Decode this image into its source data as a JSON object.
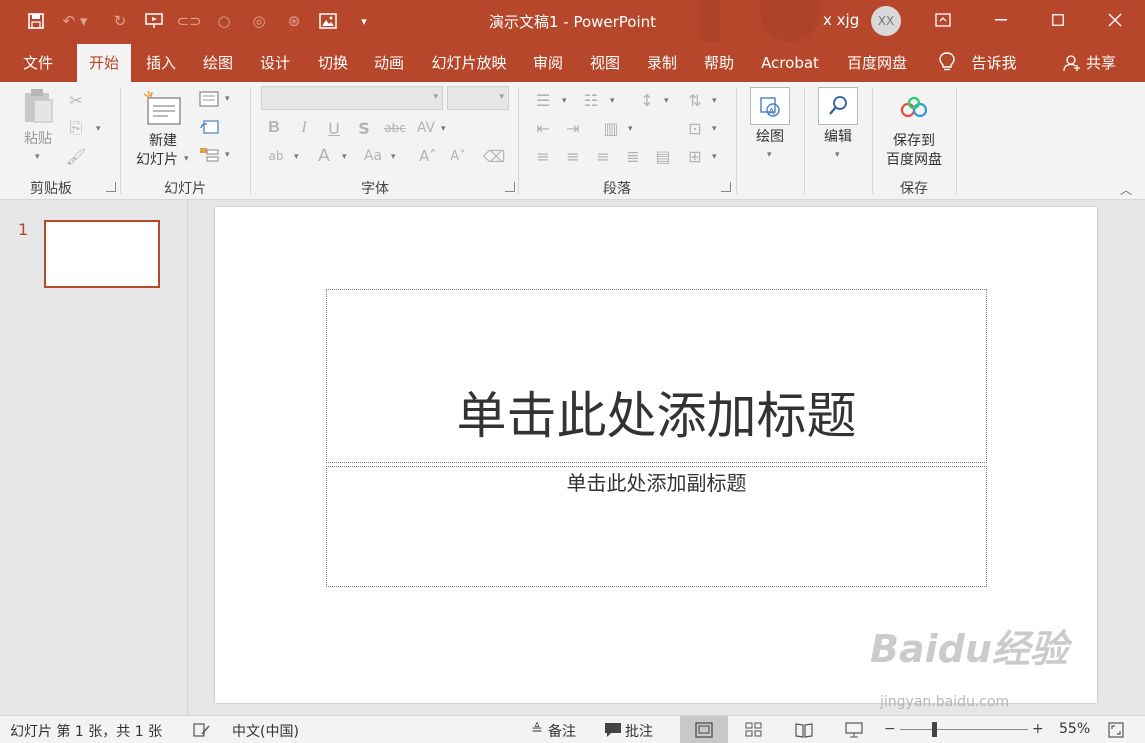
{
  "window": {
    "title": "演示文稿1  -  PowerPoint",
    "user_name": "x xjg",
    "avatar_initials": "XX",
    "accent_color": "#b7472a"
  },
  "quick_access": {
    "icons": [
      "save-icon",
      "undo-icon",
      "redo-icon",
      "present-from-start-icon",
      "shape-union-icon",
      "shape-combine-icon",
      "shape-fragment-icon",
      "shape-intersect-icon",
      "insert-picture-icon",
      "customize-toolbar-icon"
    ]
  },
  "tabs": [
    {
      "label": "文件"
    },
    {
      "label": "开始"
    },
    {
      "label": "插入"
    },
    {
      "label": "绘图"
    },
    {
      "label": "设计"
    },
    {
      "label": "切换"
    },
    {
      "label": "动画"
    },
    {
      "label": "幻灯片放映"
    },
    {
      "label": "审阅"
    },
    {
      "label": "视图"
    },
    {
      "label": "录制"
    },
    {
      "label": "帮助"
    },
    {
      "label": "Acrobat"
    },
    {
      "label": "百度网盘"
    }
  ],
  "tell_me": "告诉我",
  "share": "共享",
  "ribbon": {
    "clipboard": {
      "label": "剪贴板",
      "paste": "粘贴"
    },
    "slides": {
      "label": "幻灯片",
      "new_slide_1": "新建",
      "new_slide_2": "幻灯片"
    },
    "font": {
      "label": "字体",
      "font_name": "",
      "font_size": ""
    },
    "paragraph": {
      "label": "段落"
    },
    "drawing": {
      "label": "绘图"
    },
    "editing": {
      "label": "编辑"
    },
    "save": {
      "label": "保存",
      "save_to_1": "保存到",
      "save_to_2": "百度网盘"
    }
  },
  "thumbnails": [
    {
      "number": "1"
    }
  ],
  "slide": {
    "title_placeholder": "单击此处添加标题",
    "subtitle_placeholder": "单击此处添加副标题"
  },
  "watermark": {
    "brand": "Baidu经验",
    "url": "jingyan.baidu.com"
  },
  "status": {
    "slide_info": "幻灯片 第 1 张，共 1 张",
    "language": "中文(中国)",
    "notes": "备注",
    "comments": "批注",
    "zoom_minus": "−",
    "zoom_plus": "+",
    "zoom": "55%"
  }
}
